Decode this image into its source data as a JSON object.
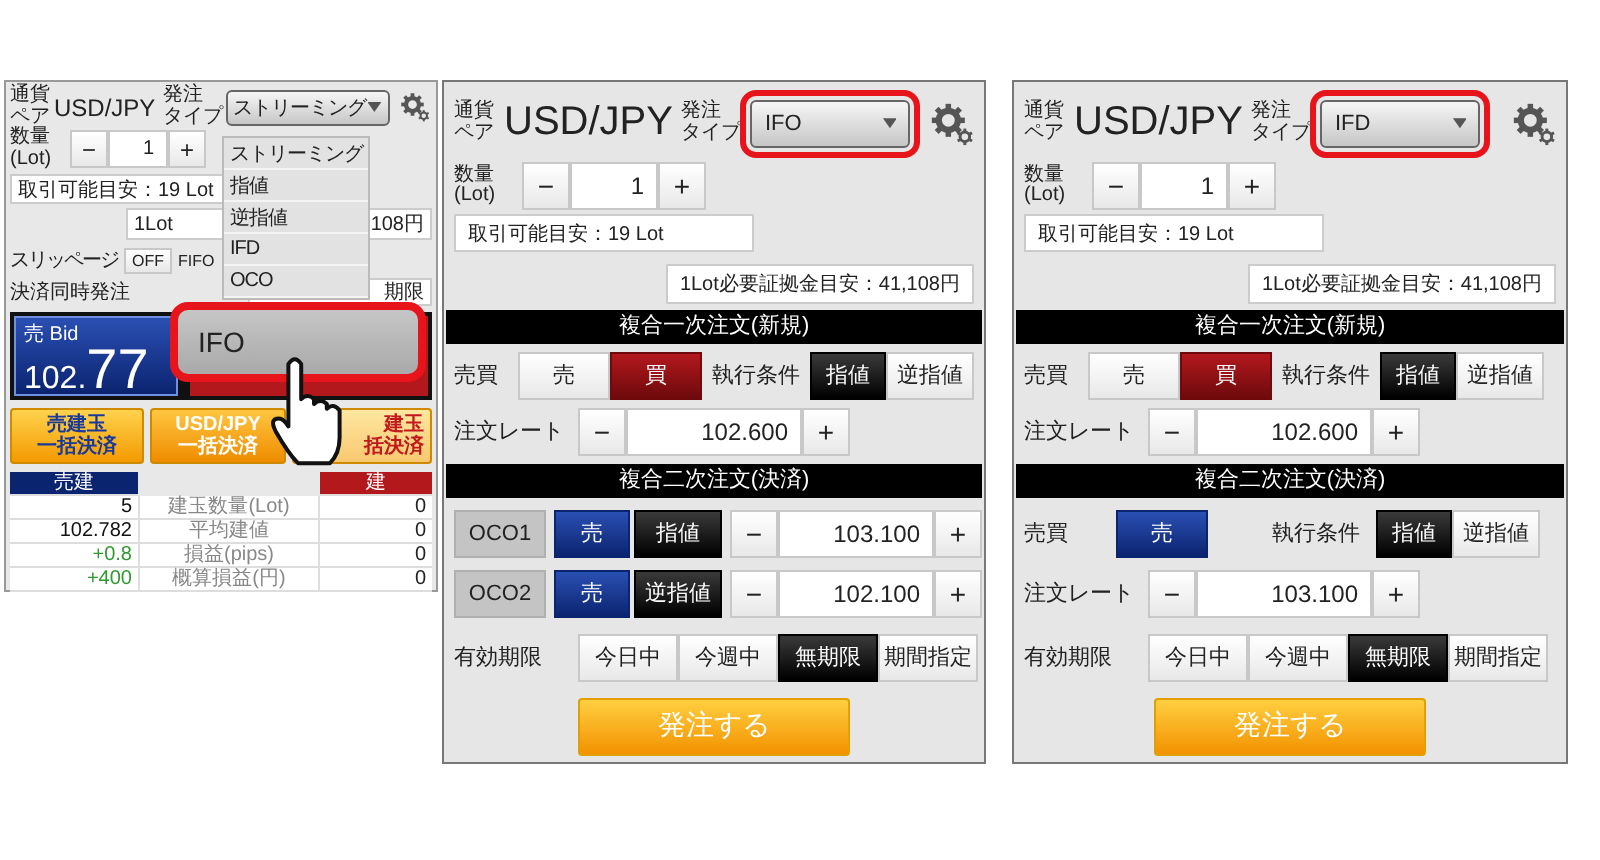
{
  "left_panel": {
    "pair_label": "通貨ペア",
    "pair": "USD/JPY",
    "order_type_label": [
      "発注",
      "タイプ"
    ],
    "order_type": {
      "label": "ストリーミング",
      "highlighted": false
    },
    "quantity_label": "数量\n(Lot)",
    "quantity": {
      "minus": "−",
      "value": "1",
      "plus": "+"
    },
    "available": "取引可能目安：19 Lot",
    "margin_start": "1Lot",
    "margin_end": "108円",
    "slippage_label": "スリッページ",
    "slippage": "OFF",
    "fifo_label": "FIFO",
    "settle_label": "決済同時発注",
    "settle_end": "期限",
    "bid": {
      "label": "売 Bid",
      "price_head": "102.",
      "price_tail": "77"
    },
    "bulk_buttons": [
      {
        "lines": [
          "売建玉",
          "一括決済"
        ],
        "kind": "sell"
      },
      {
        "lines": [
          "USD/JPY",
          "一括決済"
        ],
        "kind": "pair"
      },
      {
        "lines": [
          "建玉",
          "括決済"
        ],
        "kind": "buy"
      }
    ],
    "positions": {
      "sell_header": "売建",
      "buy_header": "建",
      "rows": [
        {
          "sell": {
            "text": "5",
            "color": "#111111"
          },
          "label": "建玉数量(Lot)",
          "buy": "0"
        },
        {
          "sell": {
            "text": "102.782",
            "color": "#111111"
          },
          "label": "平均建値",
          "buy": "0"
        },
        {
          "sell": {
            "text": "+0.8",
            "color": "#2e9a2e"
          },
          "label": "損益(pips)",
          "buy": "0"
        },
        {
          "sell": {
            "text": "+400",
            "color": "#2e9a2e"
          },
          "label": "概算損益(円)",
          "buy": "0"
        }
      ]
    },
    "dropdown": {
      "options": [
        {
          "label": "ストリーミング",
          "selected": false
        },
        {
          "label": "指値",
          "selected": false
        },
        {
          "label": "逆指値",
          "selected": false
        },
        {
          "label": "IFD",
          "selected": false
        },
        {
          "label": "OCO",
          "selected": false
        },
        {
          "label": "IFO",
          "selected": true
        }
      ]
    }
  },
  "panels": [
    {
      "pair_label": "通貨ペア",
      "pair": "USD/JPY",
      "order_type_label": [
        "発注",
        "タイプ"
      ],
      "order_type": {
        "label": "IFO",
        "highlighted": true
      },
      "quantity_label": "数量\n(Lot)",
      "quantity": {
        "minus": "−",
        "value": "1",
        "plus": "+"
      },
      "available": "取引可能目安：19 Lot",
      "margin": "1Lot必要証拠金目安：41,108円",
      "first_order": {
        "title": "複合一次注文(新規)",
        "side_label": "売買",
        "sides": [
          {
            "label": "売",
            "kind": "sell",
            "selected": false
          },
          {
            "label": "買",
            "kind": "buy",
            "selected": true
          }
        ],
        "condition_label": "執行条件",
        "conditions": [
          {
            "label": "指値",
            "selected": true
          },
          {
            "label": "逆指値",
            "selected": false
          }
        ],
        "rate_label": "注文レート",
        "rate": {
          "minus": "−",
          "value": "102.600",
          "plus": "+"
        }
      },
      "second_order": {
        "kind": "oco",
        "title": "複合二次注文(決済)",
        "legs": [
          {
            "label": "OCO1",
            "side": {
              "label": "売",
              "kind": "sell",
              "selected": true
            },
            "condition": {
              "label": "指値",
              "selected": true
            },
            "rate": {
              "minus": "−",
              "value": "103.100",
              "plus": "+"
            }
          },
          {
            "label": "OCO2",
            "side": {
              "label": "売",
              "kind": "sell",
              "selected": true
            },
            "condition": {
              "label": "逆指値",
              "selected": true
            },
            "rate": {
              "minus": "−",
              "value": "102.100",
              "plus": "+"
            }
          }
        ]
      },
      "expiry": {
        "label": "有効期限",
        "options": [
          {
            "label": "今日中",
            "selected": false
          },
          {
            "label": "今週中",
            "selected": false
          },
          {
            "label": "無期限",
            "selected": true
          },
          {
            "label": "期間指定",
            "selected": false
          }
        ]
      },
      "submit": "発注する"
    },
    {
      "pair_label": "通貨ペア",
      "pair": "USD/JPY",
      "order_type_label": [
        "発注",
        "タイプ"
      ],
      "order_type": {
        "label": "IFD",
        "highlighted": true
      },
      "quantity_label": "数量\n(Lot)",
      "quantity": {
        "minus": "−",
        "value": "1",
        "plus": "+"
      },
      "available": "取引可能目安：19 Lot",
      "margin": "1Lot必要証拠金目安：41,108円",
      "first_order": {
        "title": "複合一次注文(新規)",
        "side_label": "売買",
        "sides": [
          {
            "label": "売",
            "kind": "sell",
            "selected": false
          },
          {
            "label": "買",
            "kind": "buy",
            "selected": true
          }
        ],
        "condition_label": "執行条件",
        "conditions": [
          {
            "label": "指値",
            "selected": true
          },
          {
            "label": "逆指値",
            "selected": false
          }
        ],
        "rate_label": "注文レート",
        "rate": {
          "minus": "−",
          "value": "102.600",
          "plus": "+"
        }
      },
      "second_order": {
        "kind": "single",
        "title": "複合二次注文(決済)",
        "side_label": "売買",
        "sides": [
          {
            "label": "売",
            "kind": "sell",
            "selected": true
          }
        ],
        "condition_label": "執行条件",
        "conditions": [
          {
            "label": "指値",
            "selected": true
          },
          {
            "label": "逆指値",
            "selected": false
          }
        ],
        "rate_label": "注文レート",
        "rate": {
          "minus": "−",
          "value": "103.100",
          "plus": "+"
        }
      },
      "expiry": {
        "label": "有効期限",
        "options": [
          {
            "label": "今日中",
            "selected": false
          },
          {
            "label": "今週中",
            "selected": false
          },
          {
            "label": "無期限",
            "selected": true
          },
          {
            "label": "期間指定",
            "selected": false
          }
        ]
      },
      "submit": "発注する"
    }
  ]
}
